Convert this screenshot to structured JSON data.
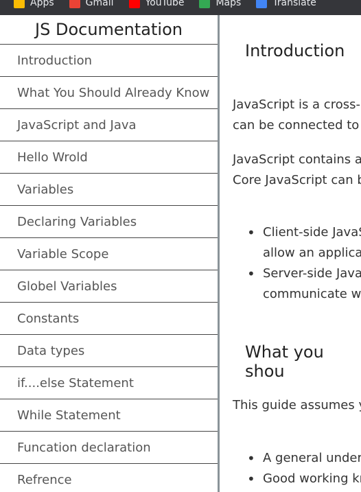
{
  "bookmarks": [
    {
      "label": "Apps",
      "icon": "apps-grid-icon",
      "color": "#fbbc04"
    },
    {
      "label": "Gmail",
      "icon": "gmail-icon",
      "color": "#ea4335"
    },
    {
      "label": "YouTube",
      "icon": "youtube-icon",
      "color": "#ff0000"
    },
    {
      "label": "Maps",
      "icon": "maps-icon",
      "color": "#34a853"
    },
    {
      "label": "Translate",
      "icon": "translate-icon",
      "color": "#4285f4"
    }
  ],
  "nav": {
    "title": "JS Documentation",
    "items": [
      "Introduction",
      "What You Should Already Know",
      "JavaScript and Java",
      "Hello Wrold",
      "Variables",
      "Declaring Variables",
      "Variable Scope",
      "Globel Variables",
      "Constants",
      "Data types",
      "if....else Statement",
      "While Statement",
      "Funcation declaration",
      "Refrence"
    ]
  },
  "main": {
    "section1": {
      "heading": "Introduction",
      "p1_line1": "JavaScript is a cross-p",
      "p1_line2": "can be connected to t",
      "p2_line1": "JavaScript contains a",
      "p2_line2": "Core JavaScript can b",
      "bullets": [
        {
          "line1": "Client-side JavaS",
          "line2": "allow an applicat"
        },
        {
          "line1": "Server-side JavaS",
          "line2": "communicate wi"
        }
      ]
    },
    "section2": {
      "heading": "What you shou",
      "p1": "This guide assumes y",
      "bullets": [
        "A general unders",
        "Good working kn"
      ]
    }
  }
}
